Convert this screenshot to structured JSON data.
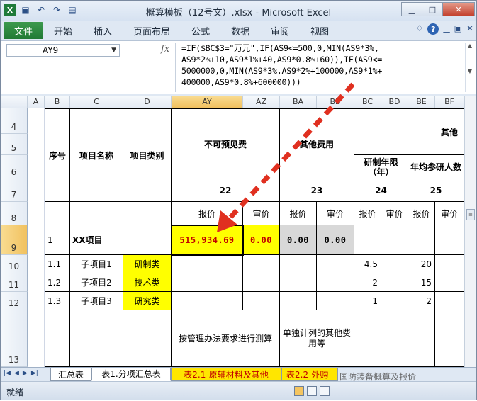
{
  "window": {
    "title": "概算模板（12号文）.xlsx - Microsoft Excel",
    "min_glyph": "▁",
    "max_glyph": "□",
    "close_glyph": "✕"
  },
  "qat": {
    "app_glyph": "X",
    "save_glyph": "▣",
    "undo_glyph": "↶",
    "redo_glyph": "↷",
    "preview_glyph": "▤"
  },
  "ribbon": {
    "file_label": "文件",
    "tabs": [
      "开始",
      "插入",
      "页面布局",
      "公式",
      "数据",
      "审阅",
      "视图"
    ],
    "help_glyph": "?"
  },
  "formula_bar": {
    "name_box": "AY9",
    "fx_label": "fx",
    "formula": "=IF($BC$3=\"万元\",IF(AS9<=500,0,MIN(AS9*3%,\nAS9*2%+10,AS9*1%+40,AS9*0.8%+60)),IF(AS9<=\n5000000,0,MIN(AS9*3%,AS9*2%+100000,AS9*1%+\n400000,AS9*0.8%+600000)))"
  },
  "columns": [
    "A",
    "B",
    "C",
    "D",
    "AY",
    "AZ",
    "BA",
    "BB",
    "BC",
    "BD",
    "BE",
    "BF"
  ],
  "rows": [
    "4",
    "5",
    "6",
    "7",
    "8",
    "9",
    "10",
    "11",
    "12",
    "13"
  ],
  "table": {
    "seq_header": "序号",
    "name_header": "项目名称",
    "type_header": "项目类别",
    "contingency_header": "不可预见费",
    "other_cost_header": "其他费用",
    "other_header": "其他",
    "dev_years_header": "研制年限（年）",
    "avg_staff_header": "年均参研人数",
    "num_22": "22",
    "num_23": "23",
    "num_24": "24",
    "num_25": "25",
    "quote": "报价",
    "review": "审价",
    "r9": {
      "seq": "1",
      "name": "XX项目",
      "ay": "515,934.69",
      "az": "0.00",
      "ba": "0.00",
      "bb": "0.00"
    },
    "r10": {
      "seq": "1.1",
      "name": "子项目1",
      "type": "研制类",
      "bc": "4.5",
      "be": "20"
    },
    "r11": {
      "seq": "1.2",
      "name": "子项目2",
      "type": "技术类",
      "bc": "2",
      "be": "15"
    },
    "r12": {
      "seq": "1.3",
      "name": "子项目3",
      "type": "研究类",
      "bc": "1",
      "be": "2"
    },
    "r13": {
      "ay": "按管理办法要求进行测算",
      "ba": "单独计列的其他费用等"
    }
  },
  "sheet_tabs": [
    "汇总表",
    "表1.分项汇总表",
    "表2.1-原辅材料及其他",
    "表2.2-外购"
  ],
  "status": {
    "ready": "就绪"
  },
  "watermark": "国防装备概算及报价",
  "colors": {
    "accent_yellow": "#ffff00",
    "value_red": "#c00000",
    "arrow_red": "#e03020"
  }
}
